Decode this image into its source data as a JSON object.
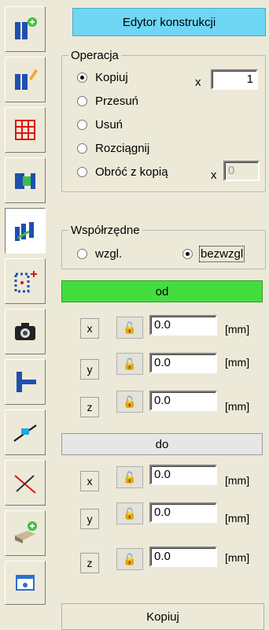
{
  "toolbar": {
    "buttons": [
      {
        "name": "add-column-icon"
      },
      {
        "name": "edit-column-icon"
      },
      {
        "name": "grid-frame-icon"
      },
      {
        "name": "join-elements-icon"
      },
      {
        "name": "move-elements-icon"
      },
      {
        "name": "add-nodes-icon"
      },
      {
        "name": "camera-icon"
      },
      {
        "name": "beam-connection-icon"
      },
      {
        "name": "connector-icon"
      },
      {
        "name": "cut-line-icon"
      },
      {
        "name": "add-plate-icon"
      },
      {
        "name": "info-window-icon"
      }
    ]
  },
  "panel": {
    "title": "Edytor konstrukcji",
    "operation": {
      "legend": "Operacja",
      "options": [
        "Kopiuj",
        "Przesuń",
        "Usuń",
        "Rozciągnij",
        "Obróć z kopią"
      ],
      "selected": "Kopiuj",
      "copies_prefix": "x",
      "copies_value": "1",
      "rotate_prefix": "x",
      "rotate_value": "0"
    },
    "coordinates": {
      "legend": "Współrzędne",
      "relative_label": "wzgl.",
      "absolute_label": "bezwzgl",
      "selected": "bezwzgl"
    },
    "from": {
      "header": "od",
      "rows": [
        {
          "axis": "x",
          "value": "0.0",
          "unit": "[mm]"
        },
        {
          "axis": "y",
          "value": "0.0",
          "unit": "[mm]"
        },
        {
          "axis": "z",
          "value": "0.0",
          "unit": "[mm]"
        }
      ]
    },
    "to": {
      "header": "do",
      "rows": [
        {
          "axis": "x",
          "value": "0.0",
          "unit": "[mm]"
        },
        {
          "axis": "y",
          "value": "0.0",
          "unit": "[mm]"
        },
        {
          "axis": "z",
          "value": "0.0",
          "unit": "[mm]"
        }
      ]
    },
    "action_button": "Kopiuj"
  },
  "colors": {
    "title_bg": "#6fd6f4",
    "from_header_bg": "#44dd3e",
    "to_header_bg": "#e6e6e6",
    "window_bg": "#ece9d8"
  }
}
